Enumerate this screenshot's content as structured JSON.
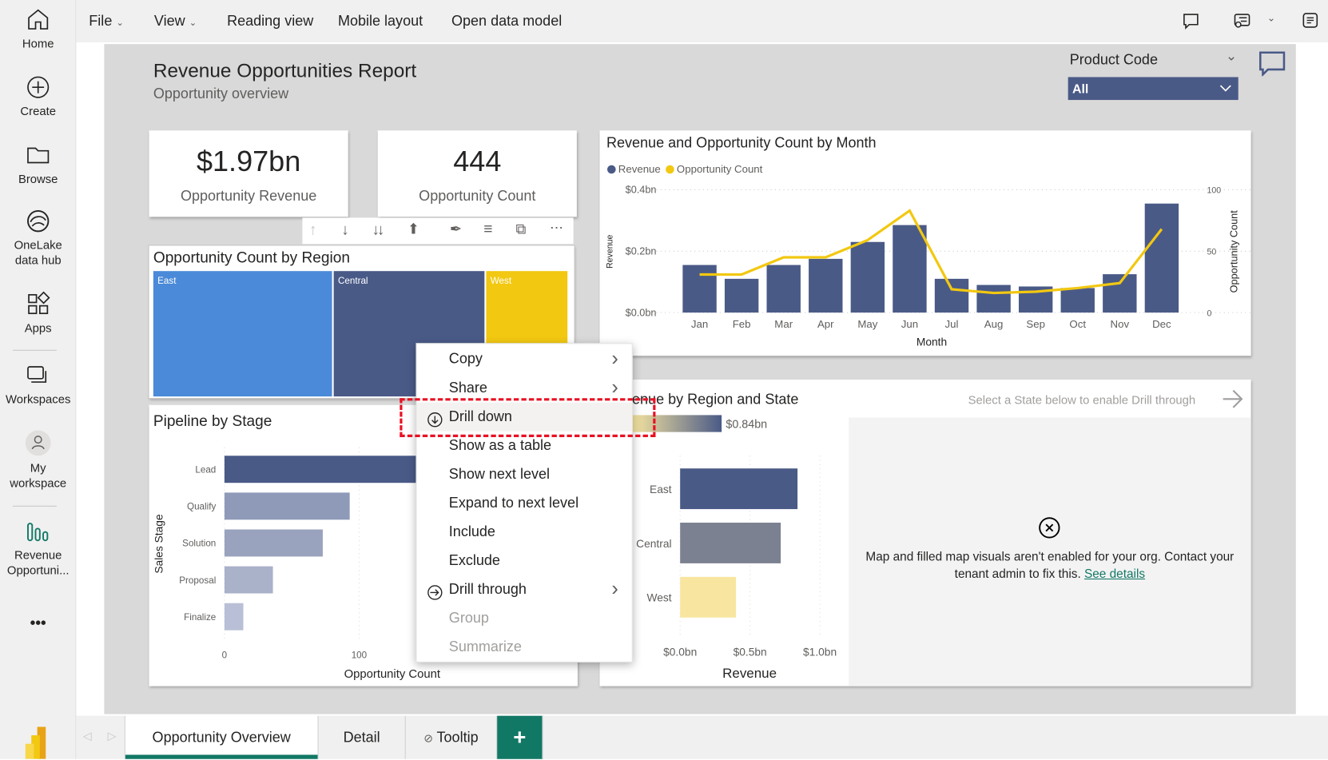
{
  "nav": {
    "items": [
      {
        "label": "Home",
        "icon": "home-icon"
      },
      {
        "label": "Create",
        "icon": "plus-circle-icon"
      },
      {
        "label": "Browse",
        "icon": "folder-icon"
      },
      {
        "label": "OneLake data hub",
        "icon": "onelake-icon"
      },
      {
        "label": "Apps",
        "icon": "apps-icon"
      },
      {
        "label": "Workspaces",
        "icon": "workspaces-icon"
      },
      {
        "label": "My workspace",
        "icon": "person-icon"
      },
      {
        "label": "Revenue Opportuni...",
        "icon": "report-icon",
        "selected": true
      }
    ],
    "more": "•••"
  },
  "menubar": {
    "items": [
      "File",
      "View",
      "Reading view",
      "Mobile layout",
      "Open data model"
    ]
  },
  "report": {
    "title": "Revenue Opportunities Report",
    "subtitle": "Opportunity overview"
  },
  "slicer": {
    "label": "Product Code",
    "value": "All"
  },
  "kpis": [
    {
      "value": "$1.97bn",
      "label": "Opportunity Revenue"
    },
    {
      "value": "444",
      "label": "Opportunity Count"
    }
  ],
  "treemap": {
    "title": "Opportunity Count by Region",
    "tiles": [
      {
        "label": "East",
        "color": "#4a8ad8"
      },
      {
        "label": "Central",
        "color": "#4a5a87"
      },
      {
        "label": "West",
        "color": "#f2c811"
      }
    ]
  },
  "chart_data": [
    {
      "type": "bar+line",
      "title": "Revenue and Opportunity Count by Month",
      "xlabel": "Month",
      "ylabel": "Revenue",
      "y2label": "Opportunity Count",
      "legend": [
        {
          "name": "Revenue",
          "color": "#4a5a87"
        },
        {
          "name": "Opportunity Count",
          "color": "#f2c811"
        }
      ],
      "legend_position": "top-left",
      "categories": [
        "Jan",
        "Feb",
        "Mar",
        "Apr",
        "May",
        "Jun",
        "Jul",
        "Aug",
        "Sep",
        "Oct",
        "Nov",
        "Dec"
      ],
      "series": [
        {
          "name": "Revenue",
          "type": "bar",
          "axis": "left",
          "values": [
            0.155,
            0.11,
            0.155,
            0.175,
            0.23,
            0.285,
            0.11,
            0.09,
            0.085,
            0.08,
            0.125,
            0.355
          ]
        },
        {
          "name": "Opportunity Count",
          "type": "line",
          "axis": "right",
          "values": [
            31,
            31,
            45,
            45,
            59,
            83,
            19,
            16,
            17,
            20,
            24,
            68
          ]
        }
      ],
      "ylim": [
        0,
        0.4
      ],
      "yticks": [
        "$0.0bn",
        "$0.2bn",
        "$0.4bn"
      ],
      "y2lim": [
        0,
        100
      ],
      "y2ticks": [
        "0",
        "50",
        "100"
      ],
      "grid": true
    },
    {
      "type": "bar",
      "orientation": "horizontal",
      "title": "Pipeline by Stage",
      "xlabel": "Opportunity Count",
      "ylabel": "Sales Stage",
      "categories": [
        "Lead",
        "Qualify",
        "Solution",
        "Proposal",
        "Finalize"
      ],
      "values": [
        160,
        93,
        73,
        36,
        14
      ],
      "colors": [
        "#4a5a87",
        "#8e9ab8",
        "#99a3bd",
        "#aab2ca",
        "#b8bfd6"
      ],
      "xticks": [
        "0",
        "100"
      ],
      "grid": true
    },
    {
      "type": "bar",
      "orientation": "horizontal",
      "title": "Revenue by Region and State",
      "xlabel": "Revenue",
      "categories": [
        "East",
        "Central",
        "West"
      ],
      "values": [
        0.84,
        0.72,
        0.4
      ],
      "colors": [
        "#4a5a87",
        "#7b8190",
        "#f8e6a0"
      ],
      "xlim": [
        0,
        1.0
      ],
      "xticks": [
        "$0.0bn",
        "$0.5bn",
        "$1.0bn"
      ],
      "color_legend_max": "$0.84bn",
      "grid": true
    }
  ],
  "drill_hint": "Select a State below to enable Drill through",
  "map_error": {
    "message": "Map and filled map visuals aren't enabled for your org. Contact your tenant admin to fix this.",
    "link": "See details"
  },
  "context_menu": [
    {
      "label": "Copy",
      "submenu": true
    },
    {
      "label": "Share",
      "submenu": true
    },
    {
      "label": "Drill down",
      "icon": "drill-down-icon",
      "highlighted": true
    },
    {
      "label": "Show as a table"
    },
    {
      "label": "Show next level"
    },
    {
      "label": "Expand to next level"
    },
    {
      "label": "Include"
    },
    {
      "label": "Exclude"
    },
    {
      "label": "Drill through",
      "icon": "drill-through-icon",
      "submenu": true
    },
    {
      "label": "Group",
      "disabled": true
    },
    {
      "label": "Summarize",
      "disabled": true
    }
  ],
  "tabs": [
    {
      "label": "Opportunity Overview",
      "active": true
    },
    {
      "label": "Detail"
    },
    {
      "label": "Tooltip",
      "hidden_icon": true
    }
  ],
  "add_page": "+",
  "colors": {
    "accent": "#117865",
    "navy": "#4a5a87",
    "yellow": "#f2c811",
    "highlight": "#e81123"
  }
}
